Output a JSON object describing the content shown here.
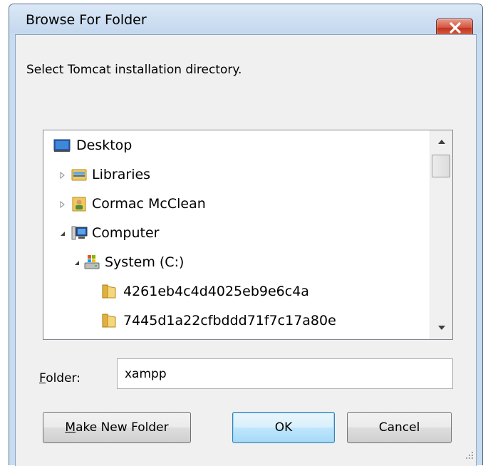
{
  "window": {
    "title": "Browse For Folder",
    "close_label": "X"
  },
  "instruction": "Select Tomcat installation directory.",
  "tree": {
    "items": [
      {
        "label": "Desktop",
        "icon": "desktop-icon",
        "expander": "none",
        "depth": 0
      },
      {
        "label": "Libraries",
        "icon": "libraries-icon",
        "expander": "collapsed",
        "depth": 1
      },
      {
        "label": "Cormac McClean",
        "icon": "user-folder-icon",
        "expander": "collapsed",
        "depth": 1
      },
      {
        "label": "Computer",
        "icon": "computer-icon",
        "expander": "expanded",
        "depth": 1
      },
      {
        "label": "System (C:)",
        "icon": "drive-icon",
        "expander": "expanded",
        "depth": 2
      },
      {
        "label": "4261eb4c4d4025eb9e6c4a",
        "icon": "folder-icon",
        "expander": "none",
        "depth": 3
      },
      {
        "label": "7445d1a22cfbddd71f7c17a80e",
        "icon": "folder-icon",
        "expander": "none",
        "depth": 3
      }
    ]
  },
  "folder": {
    "label_mnemonic": "F",
    "label_rest": "older:",
    "value": "xampp"
  },
  "buttons": {
    "make_new_folder_mnemonic": "M",
    "make_new_folder_rest": "ake New Folder",
    "ok": "OK",
    "cancel": "Cancel"
  },
  "colors": {
    "frame": "#c7dcf1",
    "client": "#f0f0f0",
    "close_button": "#c7432b",
    "default_button_border": "#3c7fb1"
  }
}
